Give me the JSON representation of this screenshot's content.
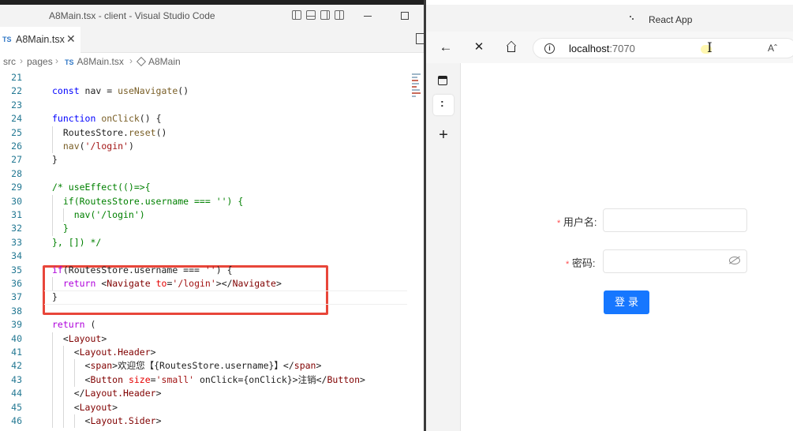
{
  "vscode": {
    "window_title": "A8Main.tsx - client - Visual Studio Code",
    "tab": {
      "badge": "TS",
      "label": "A8Main.tsx",
      "close": "✕"
    },
    "breadcrumb": [
      {
        "label": "src"
      },
      {
        "label": "pages"
      },
      {
        "badge": "TS",
        "label": "A8Main.tsx"
      },
      {
        "label": "A8Main"
      }
    ],
    "breadcrumb_sep": "›",
    "code_lines": [
      {
        "n": "21",
        "text": ""
      },
      {
        "n": "22",
        "text": "const nav = useNavigate()"
      },
      {
        "n": "23",
        "text": ""
      },
      {
        "n": "24",
        "text": "function onClick() {"
      },
      {
        "n": "25",
        "text": "  RoutesStore.reset()"
      },
      {
        "n": "26",
        "text": "  nav('/login')"
      },
      {
        "n": "27",
        "text": "}"
      },
      {
        "n": "28",
        "text": ""
      },
      {
        "n": "29",
        "text": "/* useEffect(()=>{"
      },
      {
        "n": "30",
        "text": "  if(RoutesStore.username === '') {"
      },
      {
        "n": "31",
        "text": "    nav('/login')"
      },
      {
        "n": "32",
        "text": "  }"
      },
      {
        "n": "33",
        "text": "}, []) */"
      },
      {
        "n": "34",
        "text": ""
      },
      {
        "n": "35",
        "text": "if(RoutesStore.username === '') {"
      },
      {
        "n": "36",
        "text": "  return <Navigate to='/login'></Navigate>"
      },
      {
        "n": "37",
        "text": "}"
      },
      {
        "n": "38",
        "text": ""
      },
      {
        "n": "39",
        "text": "return ("
      },
      {
        "n": "40",
        "text": "  <Layout>"
      },
      {
        "n": "41",
        "text": "    <Layout.Header>"
      },
      {
        "n": "42",
        "text": "      <span>欢迎您【{RoutesStore.username}】</span>"
      },
      {
        "n": "43",
        "text": "      <Button size='small' onClick={onClick}>注销</Button>"
      },
      {
        "n": "44",
        "text": "    </Layout.Header>"
      },
      {
        "n": "45",
        "text": "    <Layout>"
      },
      {
        "n": "46",
        "text": "      <Layout.Sider>"
      }
    ]
  },
  "browser": {
    "tab_title": "React App",
    "url_host": "localhost",
    "url_port": ":7070",
    "read_aloud": "Aˆ",
    "nav": {
      "back": "←",
      "close": "✕"
    },
    "sidebar_plus": "+",
    "form": {
      "required_mark": "*",
      "username_label": "用户名:",
      "password_label": "密码:",
      "submit_label": "登录"
    }
  },
  "colors": {
    "highlight_box": "#e8463a",
    "primary_button": "#1677ff",
    "keyword": "#0000ff",
    "string": "#a31515",
    "comment": "#008000"
  }
}
